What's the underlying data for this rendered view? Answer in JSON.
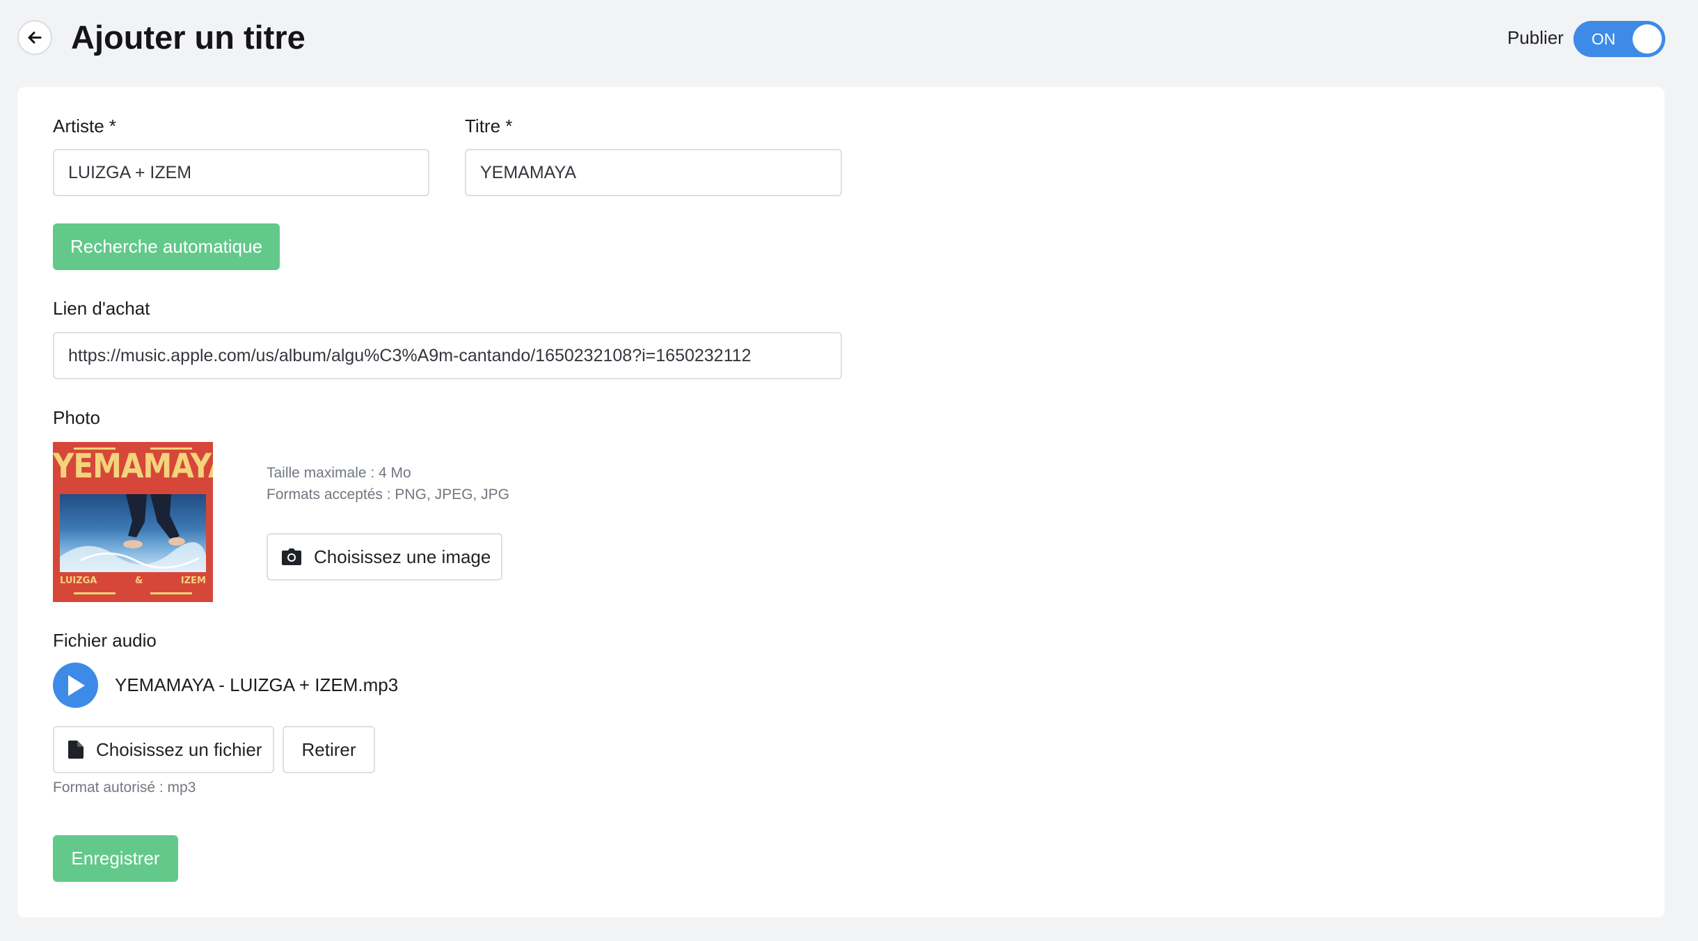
{
  "header": {
    "title": "Ajouter un titre",
    "publish_label": "Publier",
    "toggle_text": "ON"
  },
  "form": {
    "artist": {
      "label": "Artiste *",
      "value": "LUIZGA + IZEM"
    },
    "title": {
      "label": "Titre *",
      "value": "YEMAMAYA"
    },
    "auto_search_label": "Recherche automatique",
    "purchase_link": {
      "label": "Lien d'achat",
      "value": "https://music.apple.com/us/album/algu%C3%A9m-cantando/1650232108?i=1650232112"
    },
    "photo": {
      "label": "Photo",
      "max_size": "Taille maximale : 4 Mo",
      "formats": "Formats acceptés : PNG, JPEG, JPG",
      "choose_label": "Choisissez une image",
      "cover_title": "YEMAMAYA",
      "cover_left": "LUIZGA",
      "cover_mid": "&",
      "cover_right": "IZEM"
    },
    "audio": {
      "label": "Fichier audio",
      "filename": "YEMAMAYA - LUIZGA + IZEM.mp3",
      "choose_label": "Choisissez un fichier",
      "remove_label": "Retirer",
      "format_hint": "Format autorisé : mp3"
    },
    "save_label": "Enregistrer"
  },
  "colors": {
    "accent_blue": "#3d8be6",
    "accent_green": "#62c98a",
    "cover_red": "#d6473a",
    "cover_yellow": "#f3d37c"
  }
}
